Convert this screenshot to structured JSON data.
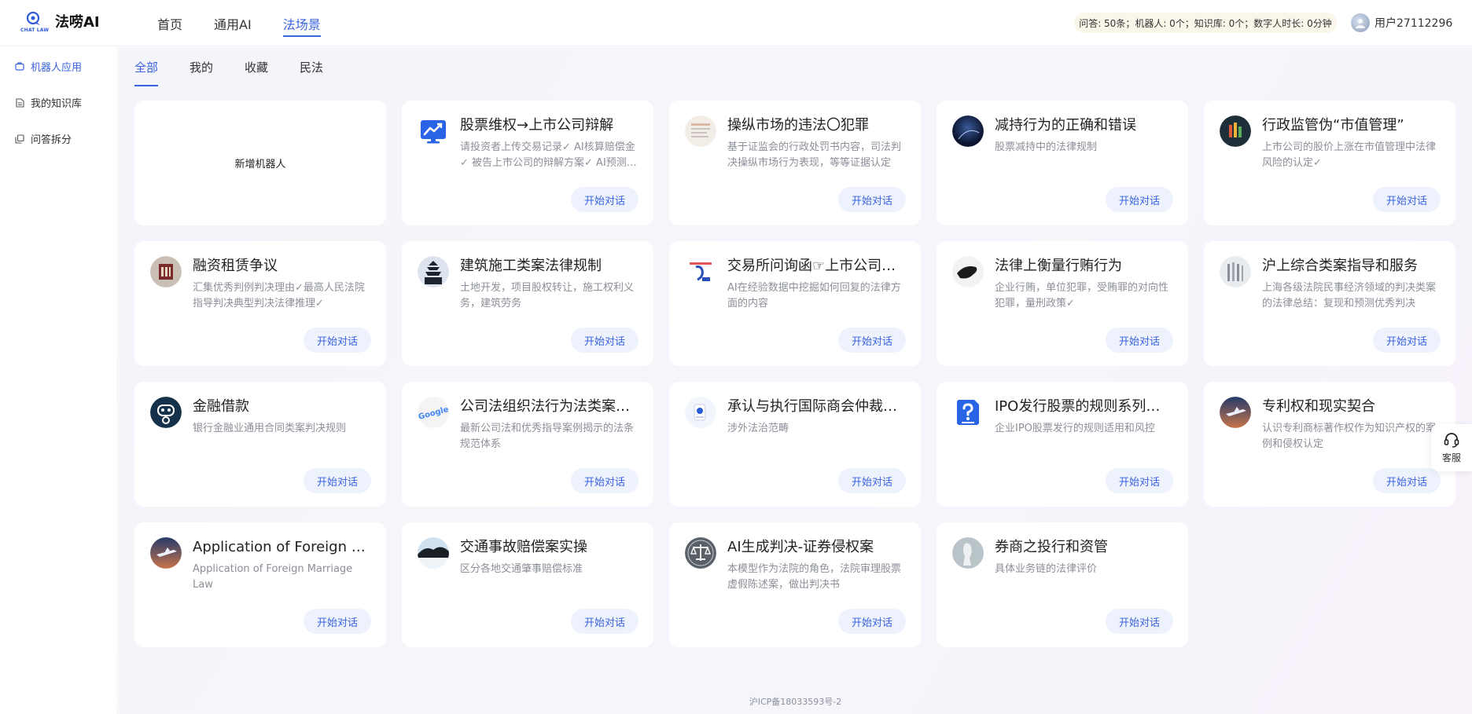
{
  "brand": {
    "name": "法唠AI",
    "logo_text": "CHAT LAW"
  },
  "nav": [
    {
      "label": "首页",
      "active": false
    },
    {
      "label": "通用AI",
      "active": false
    },
    {
      "label": "法场景",
      "active": true
    }
  ],
  "quota": {
    "text": "问答: 50条；机器人: 0个；知识库: 0个；数字人时长: 0分钟"
  },
  "user": {
    "name": "用户27112296"
  },
  "sidebar": {
    "items": [
      {
        "label": "机器人应用",
        "icon": "robot-icon",
        "active": true
      },
      {
        "label": "我的知识库",
        "icon": "document-icon",
        "active": false
      },
      {
        "label": "问答拆分",
        "icon": "copy-icon",
        "active": false
      }
    ]
  },
  "tabs": [
    {
      "label": "全部",
      "active": true
    },
    {
      "label": "我的",
      "active": false
    },
    {
      "label": "收藏",
      "active": false
    },
    {
      "label": "民法",
      "active": false
    }
  ],
  "new_robot_label": "新增机器人",
  "start_label": "开始对话",
  "cards": [
    {
      "title": "股票维权→上市公司辩解",
      "desc": "请投资者上传交易记录✓ AI核算赔偿金✓ 被告上市公司的辩解方案✓ AI预测裁判结果✓",
      "icon": "stock-chart-icon"
    },
    {
      "title": "操纵市场的违法〇犯罪",
      "desc": "基于证监会的行政处罚书内容，司法判决操纵市场行为表现，等等证据认定",
      "icon": "document-avatar-icon"
    },
    {
      "title": "减持行为的正确和错误",
      "desc": "股票减持中的法律规制",
      "icon": "night-sky-avatar-icon"
    },
    {
      "title": "行政监管伪“市值管理”",
      "desc": "上市公司的股价上涨在市值管理中法律风险的认定✓",
      "icon": "market-value-avatar-icon"
    },
    {
      "title": "融资租赁争议",
      "desc": "汇集优秀判例判决理由✓最高人民法院指导判决典型判决法律推理✓",
      "icon": "court-building-avatar-icon"
    },
    {
      "title": "建筑施工类案法律规制",
      "desc": "土地开发，项目股权转让，施工权利义务，建筑劳务",
      "icon": "pagoda-avatar-icon"
    },
    {
      "title": "交易所问询函☞上市公司回复",
      "desc": "AI在经验数据中挖掘如何回复的法律方面的内容",
      "icon": "inquiry-letter-avatar-icon"
    },
    {
      "title": "法律上衡量行贿行为",
      "desc": "企业行贿，单位犯罪，受贿罪的对向性犯罪，量刑政策✓",
      "icon": "bird-avatar-icon"
    },
    {
      "title": "沪上综合类案指导和服务",
      "desc": "上海各级法院民事经济领域的判决类案的法律总结：复现和预测优秀判决",
      "icon": "pillars-avatar-icon"
    },
    {
      "title": "金融借款",
      "desc": "银行金融业通用合同类案判决规则",
      "icon": "bank-robot-avatar-icon"
    },
    {
      "title": "公司法组织法行为法类案规则",
      "desc": "最新公司法和优秀指导案例揭示的法条规范体系",
      "icon": "google-avatar-icon"
    },
    {
      "title": "承认与执行国际商会仲裁裁决",
      "desc": "涉外法治范畴",
      "icon": "device-avatar-icon"
    },
    {
      "title": "IPO发行股票的规则系列问答",
      "desc": "企业IPO股票发行的规则适用和风控",
      "icon": "question-doc-icon"
    },
    {
      "title": "专利权和现实契合",
      "desc": "认识专利商标著作权作为知识产权的案例和侵权认定",
      "icon": "jet-avatar-icon"
    },
    {
      "title": "Application of Foreign Marriage Law",
      "desc": "Application of Foreign Marriage Law",
      "icon": "jet-avatar-icon"
    },
    {
      "title": "交通事故赔偿案实操",
      "desc": "区分各地交通肇事赔偿标准",
      "icon": "landscape-avatar-icon"
    },
    {
      "title": "AI生成判决-证券侵权案",
      "desc": "本模型作为法院的角色，法院审理股票虚假陈述案，做出判决书",
      "icon": "scales-avatar-icon"
    },
    {
      "title": "券商之投行和资管",
      "desc": "具体业务链的法律评价",
      "icon": "statue-avatar-icon"
    }
  ],
  "footer": {
    "icp": "沪ICP备18033593号-2"
  },
  "service": {
    "label": "客服"
  },
  "colors": {
    "accent": "#3a63e0",
    "button_bg": "#eef2fd",
    "quota_bg": "#fbf6ea"
  }
}
